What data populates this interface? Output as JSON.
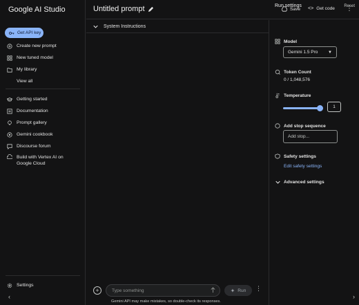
{
  "app": {
    "name": "Google AI Studio"
  },
  "sidebar": {
    "get_api_key": "Get API key",
    "primary_items": [
      {
        "label": "Create new prompt",
        "icon": "add-circle-icon"
      },
      {
        "label": "New tuned model",
        "icon": "tune-icon"
      },
      {
        "label": "My library",
        "icon": "folder-icon"
      },
      {
        "label": "View all",
        "icon": ""
      }
    ],
    "secondary_items": [
      {
        "label": "Getting started",
        "icon": "graduation-cap-icon"
      },
      {
        "label": "Documentation",
        "icon": "document-icon"
      },
      {
        "label": "Prompt gallery",
        "icon": "lightbulb-icon"
      },
      {
        "label": "Gemini cookbook",
        "icon": "github-icon"
      },
      {
        "label": "Discourse forum",
        "icon": "chat-icon"
      },
      {
        "label": "Build with Vertex AI on Google Cloud",
        "icon": "cloud-icon"
      }
    ],
    "settings": "Settings"
  },
  "header": {
    "title": "Untitled prompt",
    "save": "Save",
    "get_code": "Get code"
  },
  "editor": {
    "system_instructions": "System Instructions",
    "input_placeholder": "Type something",
    "run": "Run",
    "disclaimer": "Gemini API may make mistakes, so double-check its responses."
  },
  "run_settings": {
    "title": "Run settings",
    "reset": "Reset",
    "model_label": "Model",
    "model_value": "Gemini 1.5 Pro",
    "token_count_label": "Token Count",
    "token_count_value": "0 / 1,048,576",
    "temperature_label": "Temperature",
    "temperature_value": "1",
    "temperature_fraction": 1.0,
    "stop_sequence_label": "Add stop sequence",
    "stop_placeholder": "Add stop...",
    "safety_label": "Safety settings",
    "safety_link": "Edit safety settings",
    "advanced_label": "Advanced settings"
  },
  "colors": {
    "background": "#131314",
    "accent": "#8ab4f8",
    "border": "#2c2c2e",
    "text": "#e3e3e3"
  }
}
